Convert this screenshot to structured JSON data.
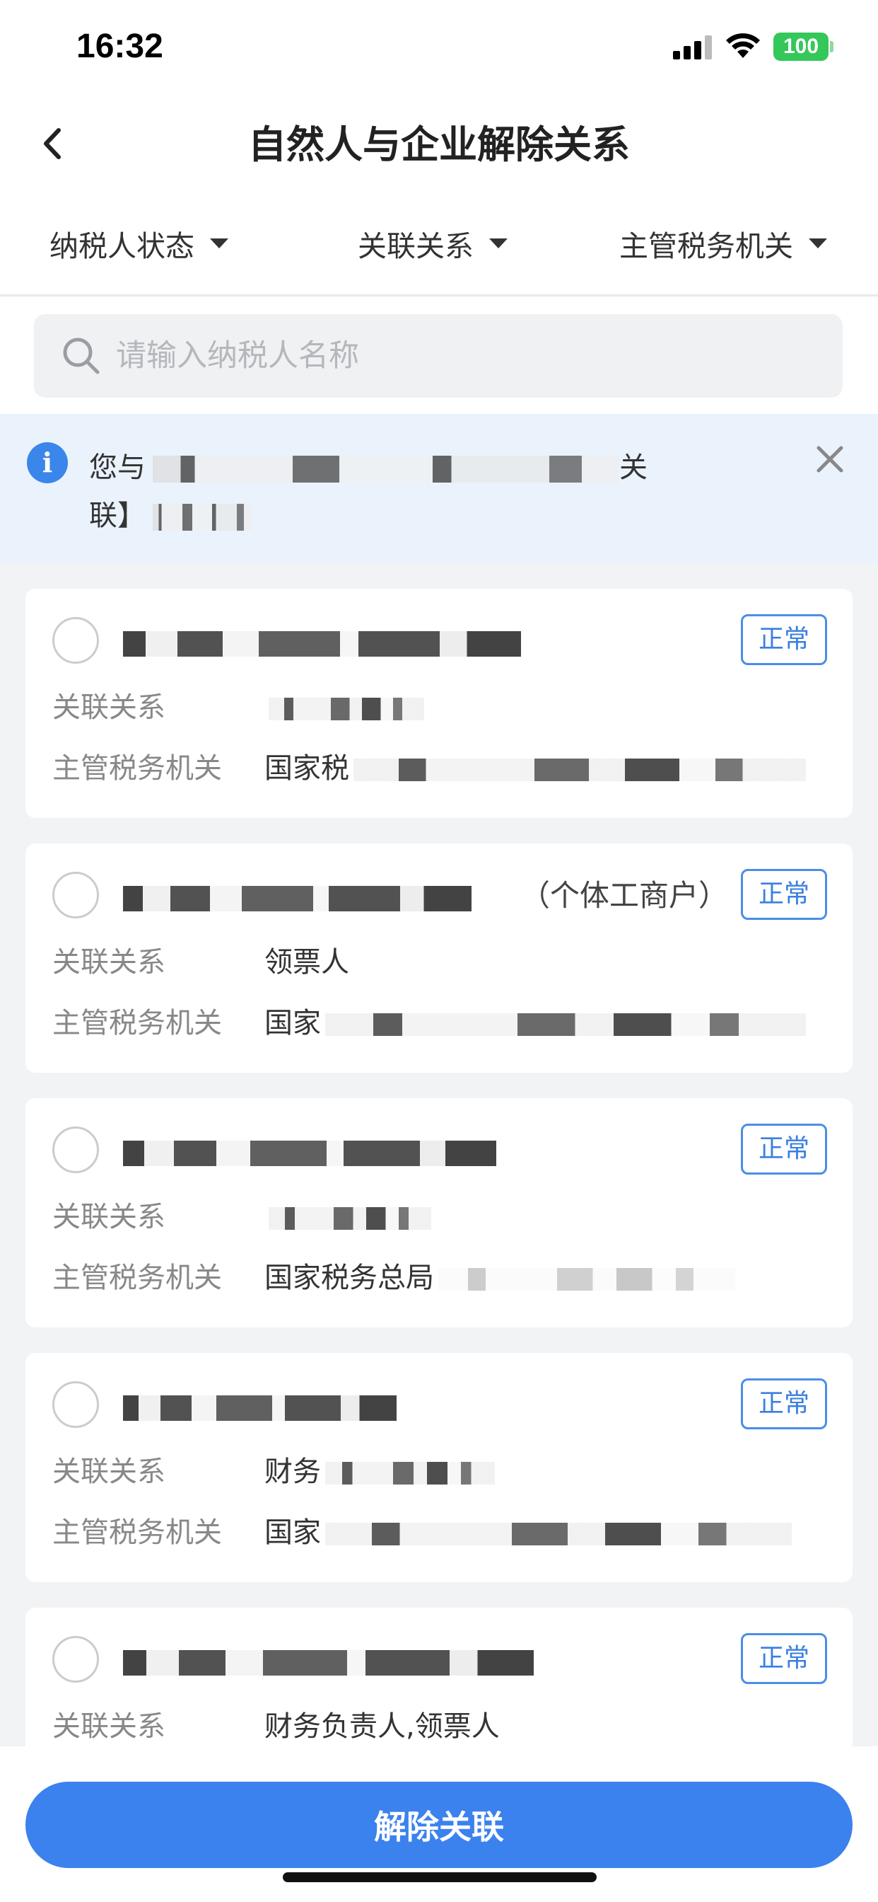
{
  "status_bar": {
    "time": "16:32",
    "battery": "100"
  },
  "nav": {
    "title": "自然人与企业解除关系",
    "back_icon": "chevron-left-icon"
  },
  "filters": [
    {
      "label": "纳税人状态"
    },
    {
      "label": "关联关系"
    },
    {
      "label": "主管税务机关"
    }
  ],
  "search": {
    "placeholder": "请输入纳税人名称",
    "value": ""
  },
  "notice": {
    "text_start": "您与",
    "text_mid": "关",
    "text_line2": "联】"
  },
  "labels": {
    "relation": "关联关系",
    "authority": "主管税务机关"
  },
  "cards": [
    {
      "name_suffix": "",
      "status": "正常",
      "relation": "",
      "authority": "国家税"
    },
    {
      "name_suffix": "（个体工商户）",
      "status": "正常",
      "relation": "领票人",
      "authority": "国家"
    },
    {
      "name_suffix": "",
      "status": "正常",
      "relation": "",
      "authority": "国家税务总局"
    },
    {
      "name_suffix": "",
      "status": "正常",
      "relation": "财务",
      "authority": "国家"
    },
    {
      "name_suffix": "",
      "status": "正常",
      "relation": "财务负责人,领票人",
      "authority": ""
    }
  ],
  "bottom": {
    "release_label": "解除关联"
  },
  "colors": {
    "primary": "#3b82ee",
    "badge": "#4a8ee6",
    "notice_bg": "#eaf3fc",
    "battery": "#34c759"
  }
}
